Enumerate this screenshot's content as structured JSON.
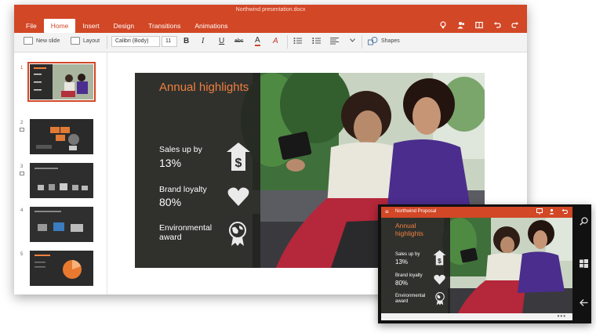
{
  "window": {
    "title": "Northwind presentation.docx"
  },
  "tabs": [
    "File",
    "Home",
    "Insert",
    "Design",
    "Transitions",
    "Animations"
  ],
  "ribbon": {
    "new_slide": "New slide",
    "layout": "Layout",
    "font_name": "Calibri (Body)",
    "font_size": "11",
    "bold": "B",
    "italic": "I",
    "underline": "U",
    "strike": "abc",
    "font_color": "A",
    "highlight": "A",
    "shapes": "Shapes"
  },
  "thumbnails": [
    {
      "num": "1",
      "selected": true
    },
    {
      "num": "2"
    },
    {
      "num": "3"
    },
    {
      "num": "4"
    },
    {
      "num": "5"
    }
  ],
  "slide": {
    "title": "Annual highlights",
    "stats": [
      {
        "label": "Sales up by",
        "value": "13%",
        "icon": "dollar-shield-icon"
      },
      {
        "label": "Brand loyalty",
        "value": "80%",
        "icon": "heart-icon"
      },
      {
        "label": "Environmental award",
        "value": "",
        "icon": "globe-ribbon-icon"
      }
    ]
  },
  "phone": {
    "title": "Northwind Proposal",
    "slide_title": "Annual highlights",
    "stats": [
      {
        "label": "Sales up by",
        "value": "13%"
      },
      {
        "label": "Brand loyalty",
        "value": "80%"
      },
      {
        "label": "Environmental award",
        "value": ""
      }
    ],
    "more": "•••"
  },
  "colors": {
    "accent": "#d24726",
    "title_orange": "#ee7f3f",
    "panel": "#232321"
  }
}
